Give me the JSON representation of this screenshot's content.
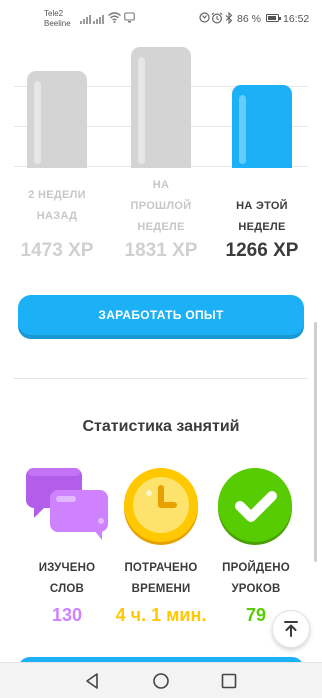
{
  "status_bar": {
    "carrier_1": "Tele2",
    "carrier_2": "Beeline",
    "battery": "86 %",
    "time": "16:52"
  },
  "chart_data": {
    "type": "bar",
    "categories": [
      "2 НЕДЕЛИ НАЗАД",
      "НА ПРОШЛОЙ НЕДЕЛЕ",
      "НА ЭТОЙ НЕДЕЛЕ"
    ],
    "category_lines": [
      [
        "2 НЕДЕЛИ",
        "НАЗАД"
      ],
      [
        "НА",
        "ПРОШЛОЙ",
        "НЕДЕЛЕ"
      ],
      [
        "НА ЭТОЙ",
        "НЕДЕЛЕ"
      ]
    ],
    "values": [
      1473,
      1831,
      1266
    ],
    "value_labels": [
      "1473 XP",
      "1831 XP",
      "1266 XP"
    ],
    "ylim": [
      0,
      1931
    ],
    "colors": [
      "#d4d4d4",
      "#d4d4d4",
      "#1cb0f6"
    ],
    "grid": true
  },
  "earn_button": {
    "label": "ЗАРАБОТАТЬ ОПЫТ"
  },
  "stats": {
    "title": "Статистика занятий",
    "items": [
      {
        "label_lines": [
          "ИЗУЧЕНО",
          "СЛОВ"
        ],
        "value": "130",
        "color": "#ce82ff",
        "icon": "speech-bubbles-icon"
      },
      {
        "label_lines": [
          "ПОТРАЧЕНО",
          "ВРЕМЕНИ"
        ],
        "value": "4 ч. 1 мин.",
        "color": "#ffc800",
        "icon": "clock-icon"
      },
      {
        "label_lines": [
          "ПРОЙДЕНО",
          "УРОКОВ"
        ],
        "value": "79",
        "color": "#58cc02",
        "icon": "checkmark-icon"
      }
    ]
  },
  "scroll_top_button": {
    "icon": "arrow-up-icon"
  },
  "nav_bar": {
    "icons": [
      "back-icon",
      "home-icon",
      "recents-icon"
    ]
  }
}
